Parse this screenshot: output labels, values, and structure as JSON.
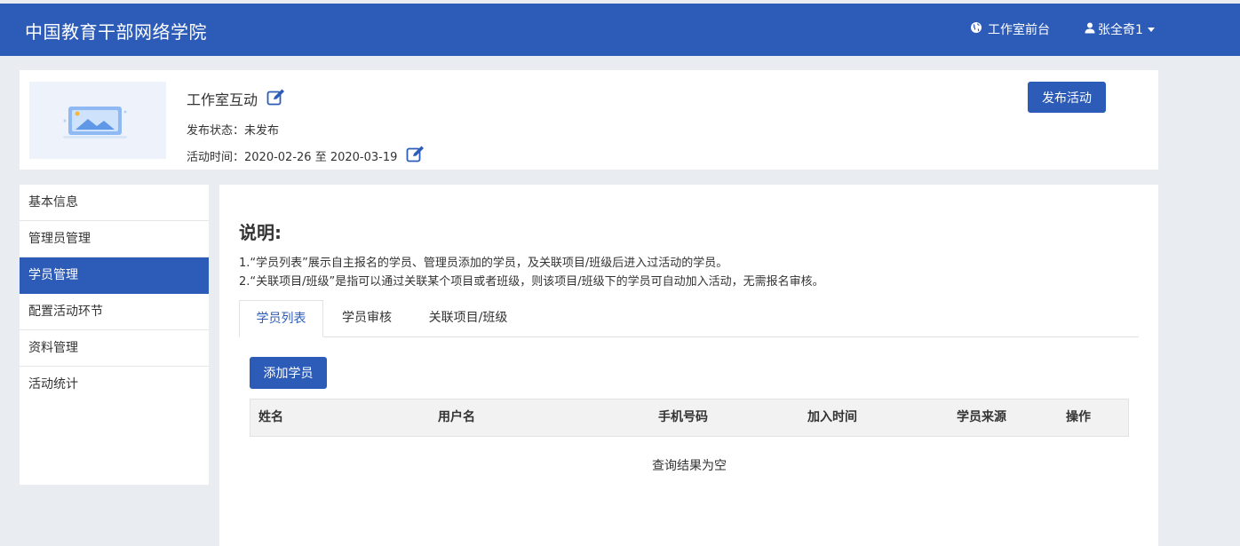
{
  "topbar": {
    "brand": "中国教育干部网络学院",
    "front_link": "工作室前台",
    "user_name": "张全奇1",
    "icons": {
      "front": "globe-icon",
      "user": "user-icon"
    }
  },
  "activity": {
    "title": "工作室互动",
    "status_label": "发布状态：",
    "status_value": "未发布",
    "time_label": "活动时间：",
    "time_value": "2020-02-26 至 2020-03-19",
    "publish_button": "发布活动"
  },
  "sidebar": {
    "items": [
      {
        "label": "基本信息",
        "active": false
      },
      {
        "label": "管理员管理",
        "active": false
      },
      {
        "label": "学员管理",
        "active": true
      },
      {
        "label": "配置活动环节",
        "active": false
      },
      {
        "label": "资料管理",
        "active": false
      },
      {
        "label": "活动统计",
        "active": false
      }
    ]
  },
  "main": {
    "desc_title": "说明:",
    "desc_lines": [
      "1.“学员列表”展示自主报名的学员、管理员添加的学员，及关联项目/班级后进入过活动的学员。",
      "2.“关联项目/班级”是指可以通过关联某个项目或者班级，则该项目/班级下的学员可自动加入活动，无需报名审核。"
    ],
    "tabs": [
      {
        "label": "学员列表",
        "active": true
      },
      {
        "label": "学员审核",
        "active": false
      },
      {
        "label": "关联项目/班级",
        "active": false
      }
    ],
    "add_button": "添加学员",
    "table": {
      "columns": [
        "姓名",
        "用户名",
        "手机号码",
        "加入时间",
        "学员来源",
        "操作"
      ],
      "rows": [],
      "empty_text": "查询结果为空"
    }
  },
  "colors": {
    "primary": "#2c5bb8",
    "background": "#e9edf1"
  }
}
